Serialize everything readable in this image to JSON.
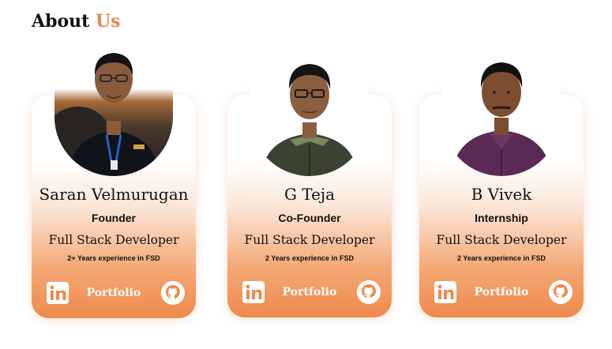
{
  "section": {
    "title_main": "About",
    "title_accent": "Us",
    "accent_color": "#e9884a"
  },
  "members": [
    {
      "name": "Saran Velmurugan",
      "role": "Founder",
      "title": "Full Stack Developer",
      "experience": "2+ Years experience in FSD",
      "portfolio_label": "Portfolio",
      "icons": [
        "linkedin-icon",
        "github-icon"
      ]
    },
    {
      "name": "G Teja",
      "role": "Co-Founder",
      "title": "Full Stack Developer",
      "experience": "2 Years experience in FSD",
      "portfolio_label": "Portfolio",
      "icons": [
        "linkedin-icon",
        "github-icon"
      ]
    },
    {
      "name": "B Vivek",
      "role": "Internship",
      "title": "Full Stack Developer",
      "experience": "2 Years experience in FSD",
      "portfolio_label": "Portfolio",
      "icons": [
        "linkedin-icon",
        "github-icon"
      ]
    }
  ]
}
